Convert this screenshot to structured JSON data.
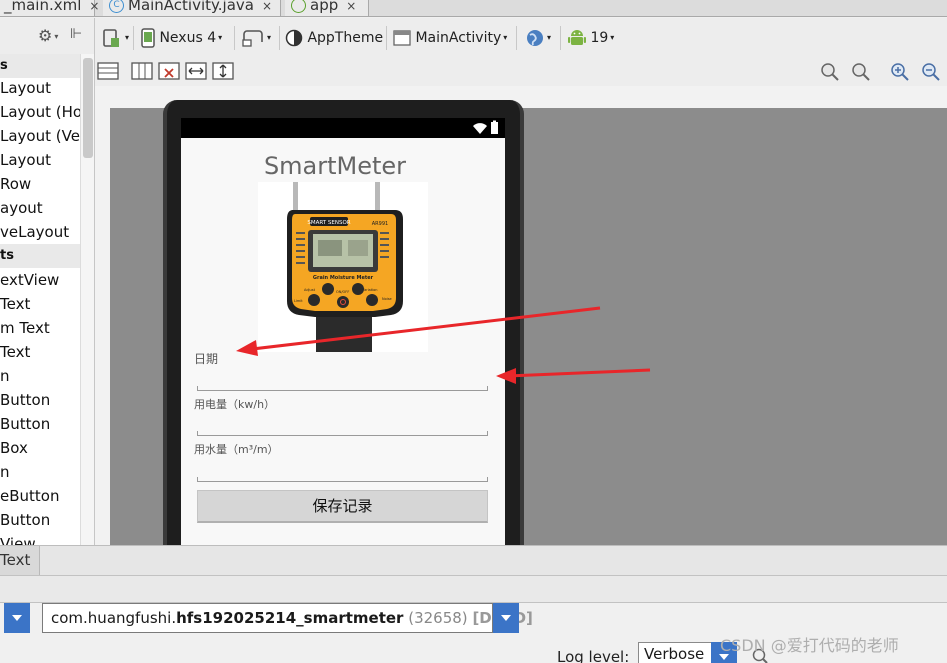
{
  "tabs": [
    {
      "label": "_main.xml",
      "close": "×"
    },
    {
      "label": "MainActivity.java",
      "icon": "C",
      "close": "×"
    },
    {
      "label": "app",
      "close": "×"
    }
  ],
  "toolbar": {
    "device": "Nexus 4",
    "theme": "AppTheme",
    "activity": "MainActivity",
    "api": "19"
  },
  "palette": {
    "items": [
      {
        "label": "s",
        "category": true
      },
      {
        "label": "Layout"
      },
      {
        "label": "Layout (Ho"
      },
      {
        "label": "Layout (Ver"
      },
      {
        "label": "Layout"
      },
      {
        "label": "Row"
      },
      {
        "label": "ayout"
      },
      {
        "label": "veLayout"
      },
      {
        "label": "ts",
        "category": true
      },
      {
        "label": "extView"
      },
      {
        "label": "Text"
      },
      {
        "label": "m Text"
      },
      {
        "label": "Text"
      },
      {
        "label": "n"
      },
      {
        "label": "Button"
      },
      {
        "label": "Button"
      },
      {
        "label": "Box"
      },
      {
        "label": "n"
      },
      {
        "label": "eButton"
      },
      {
        "label": "Button"
      },
      {
        "label": "View"
      }
    ]
  },
  "app": {
    "title": "SmartMeter",
    "date_label": "日期",
    "electricity_label": "用电量（kw/h）",
    "water_label": "用水量（m³/m）",
    "save_button": "保存记录"
  },
  "meter": {
    "brand": "SMART SENSOR",
    "model": "AR991",
    "caption": "Grain Moisture Meter",
    "buttons": [
      "Adjust",
      "ON/OFF",
      "Variation",
      "Limit",
      "Noise"
    ]
  },
  "bottom": {
    "text_tab": "Text",
    "process_package": "com.huangfushi.",
    "process_name": "hfs192025214_smartmeter",
    "process_pid": "(32658)",
    "process_state": "[DEAD]",
    "log_level_label": "Log level:",
    "log_level_value": "Verbose",
    "watermark": "CSDN @爱打代码的老师"
  },
  "colors": {
    "annotation_arrow": "#e8262a",
    "meter_body": "#f5a623",
    "dropdown_blue": "#3b74c7"
  }
}
